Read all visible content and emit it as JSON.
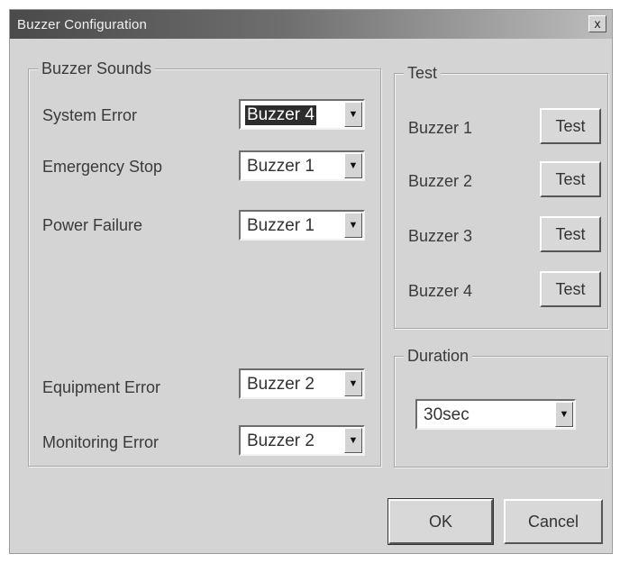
{
  "window": {
    "title": "Buzzer Configuration",
    "close_label": "x"
  },
  "buzzer_sounds": {
    "legend": "Buzzer Sounds",
    "items": [
      {
        "label": "System Error",
        "value": "Buzzer 4"
      },
      {
        "label": "Emergency Stop",
        "value": "Buzzer 1"
      },
      {
        "label": "Power Failure",
        "value": "Buzzer 1"
      },
      {
        "label": "Equipment Error",
        "value": "Buzzer 2"
      },
      {
        "label": "Monitoring Error",
        "value": "Buzzer 2"
      }
    ]
  },
  "test": {
    "legend": "Test",
    "items": [
      {
        "label": "Buzzer 1",
        "button": "Test"
      },
      {
        "label": "Buzzer 2",
        "button": "Test"
      },
      {
        "label": "Buzzer 3",
        "button": "Test"
      },
      {
        "label": "Buzzer 4",
        "button": "Test"
      }
    ]
  },
  "duration": {
    "legend": "Duration",
    "value": "30sec"
  },
  "buttons": {
    "ok": "OK",
    "cancel": "Cancel"
  },
  "icons": {
    "dropdown": "dropdown-arrow-icon",
    "close": "close-icon"
  }
}
